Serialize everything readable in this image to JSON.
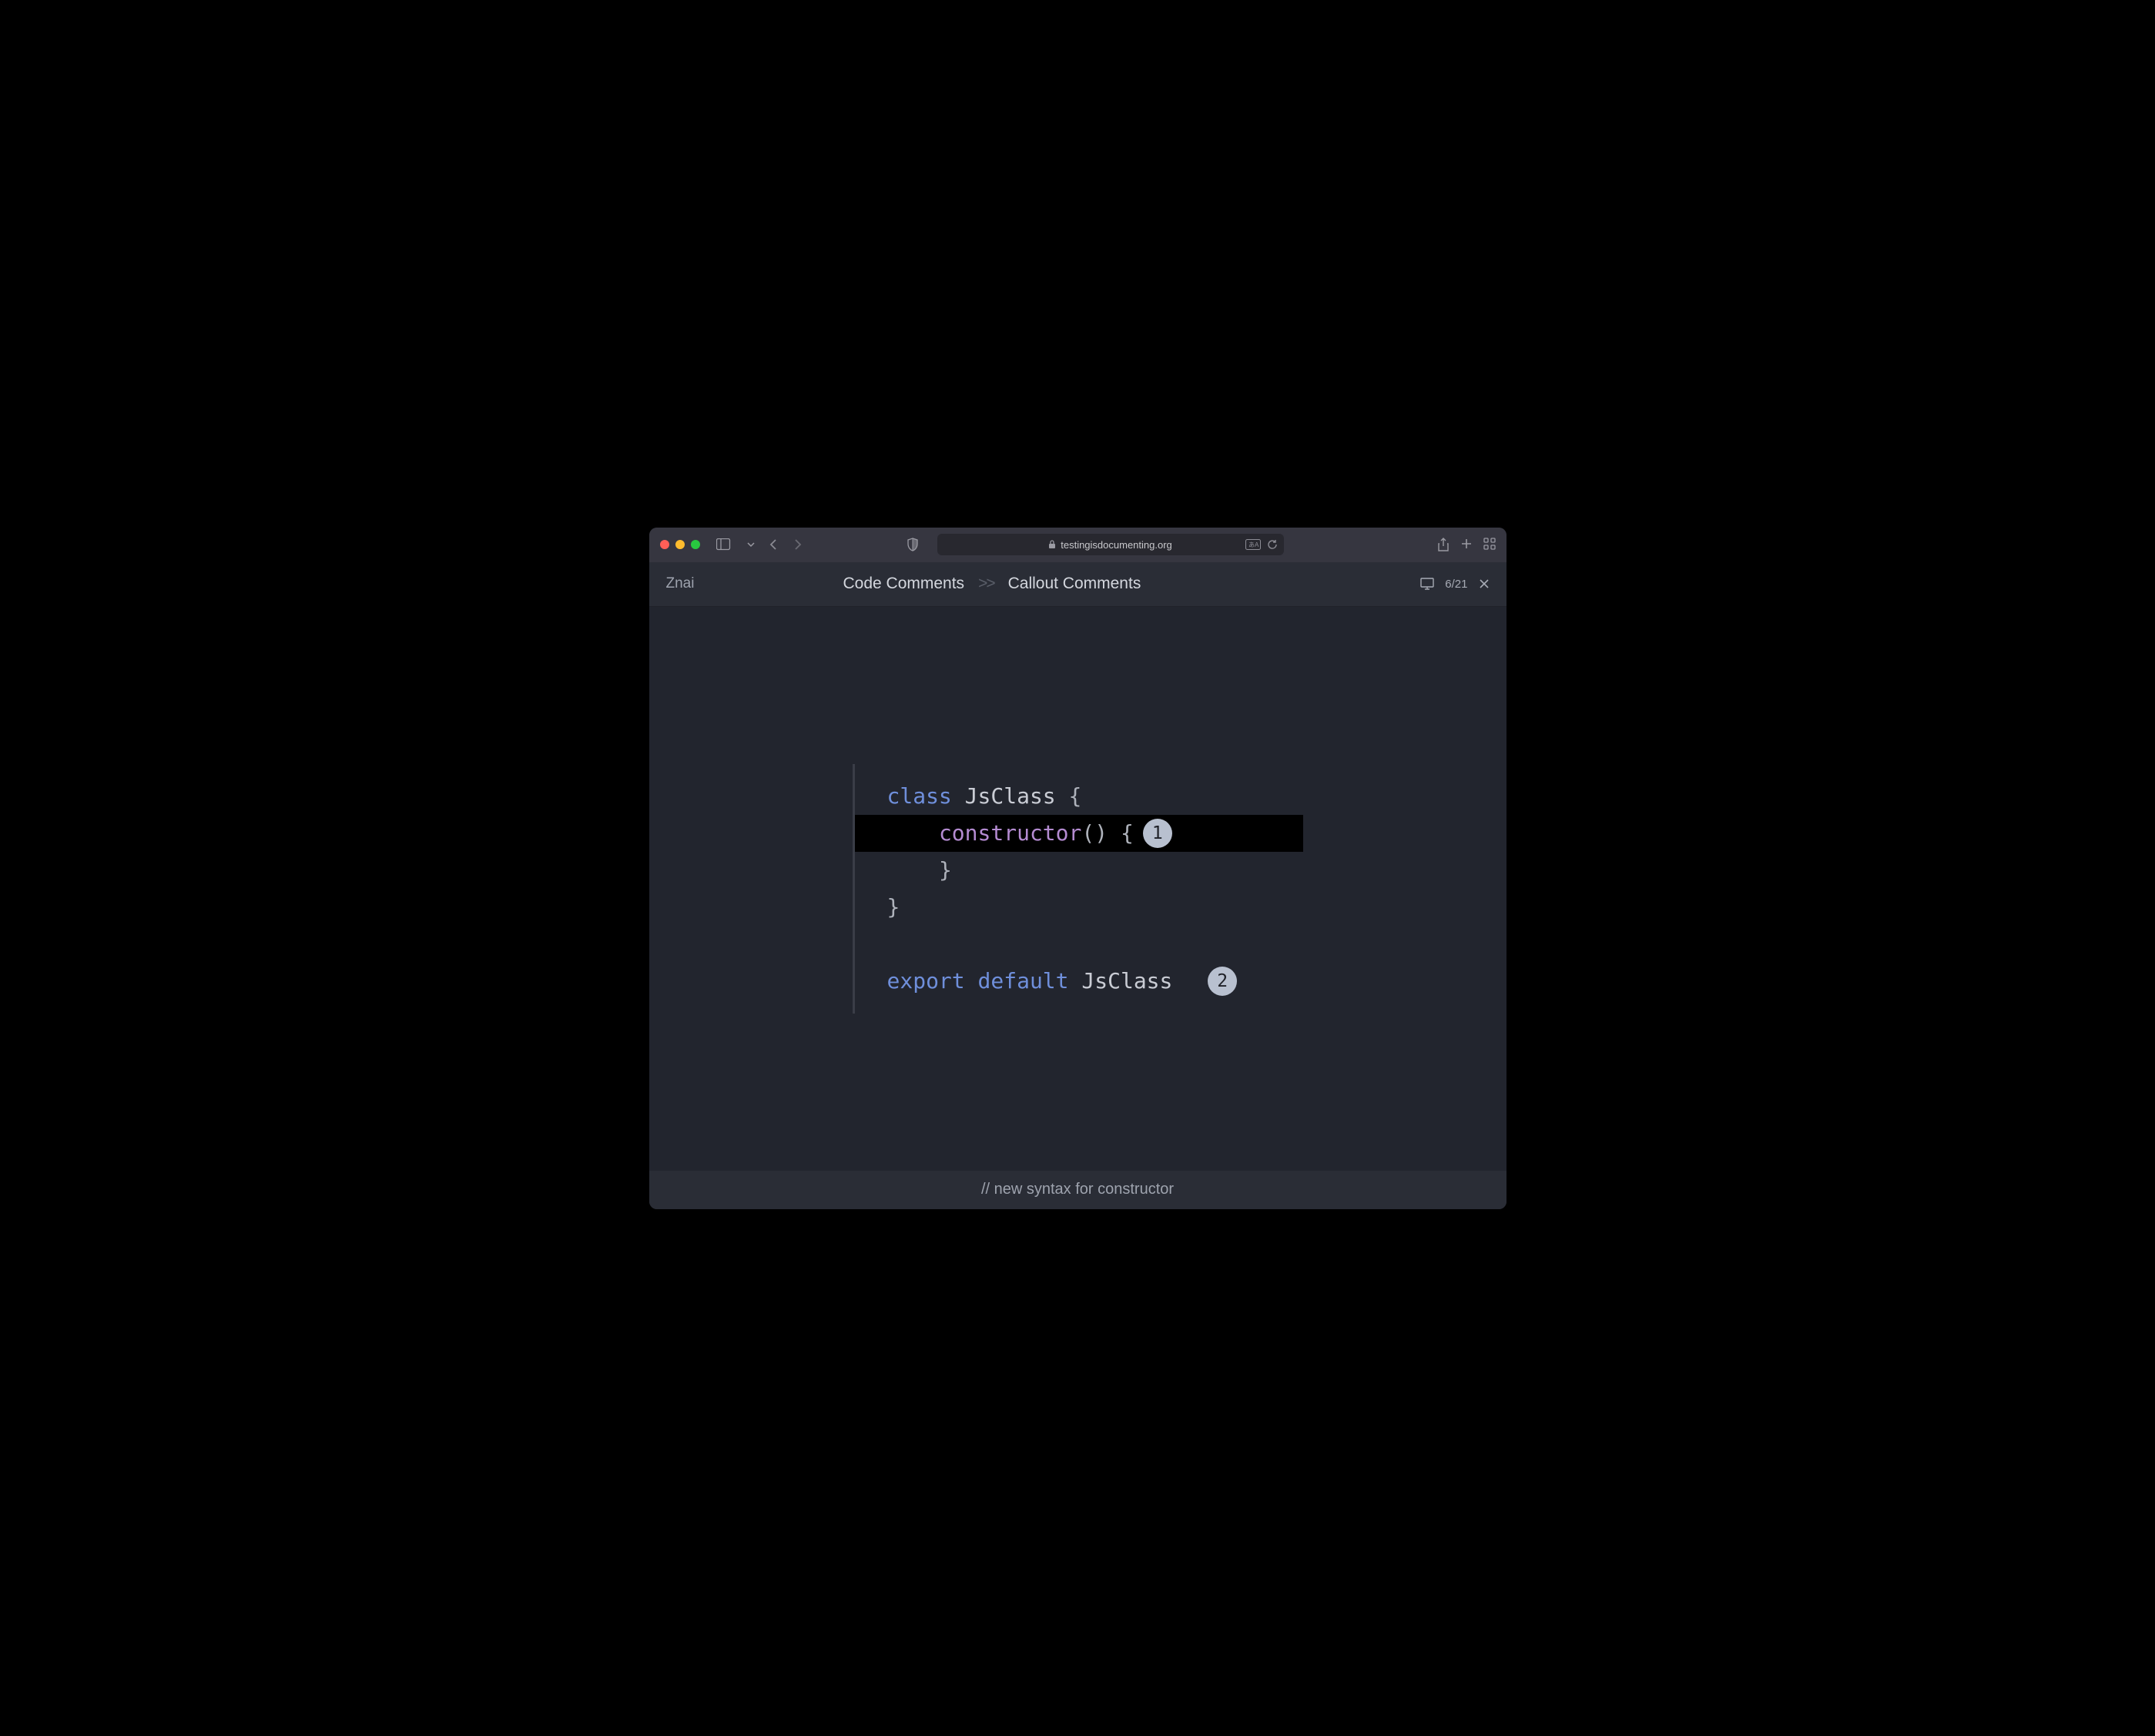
{
  "chrome": {
    "url": "testingisdocumenting.org"
  },
  "header": {
    "app_name": "Znai",
    "crumb1": "Code Comments",
    "crumb_sep": ">>",
    "crumb2": "Callout Comments",
    "counter": "6/21"
  },
  "code": {
    "kw_class": "class",
    "class_name": "JsClass",
    "open_brace": " {",
    "ctor": "constructor",
    "ctor_rest": "() {",
    "close_brace_inner": "}",
    "close_brace_outer": "}",
    "kw_export": "export",
    "kw_default": "default",
    "export_name": "JsClass",
    "badge1": "1",
    "badge2": "2"
  },
  "footer": {
    "text": "// new syntax for constructor"
  }
}
